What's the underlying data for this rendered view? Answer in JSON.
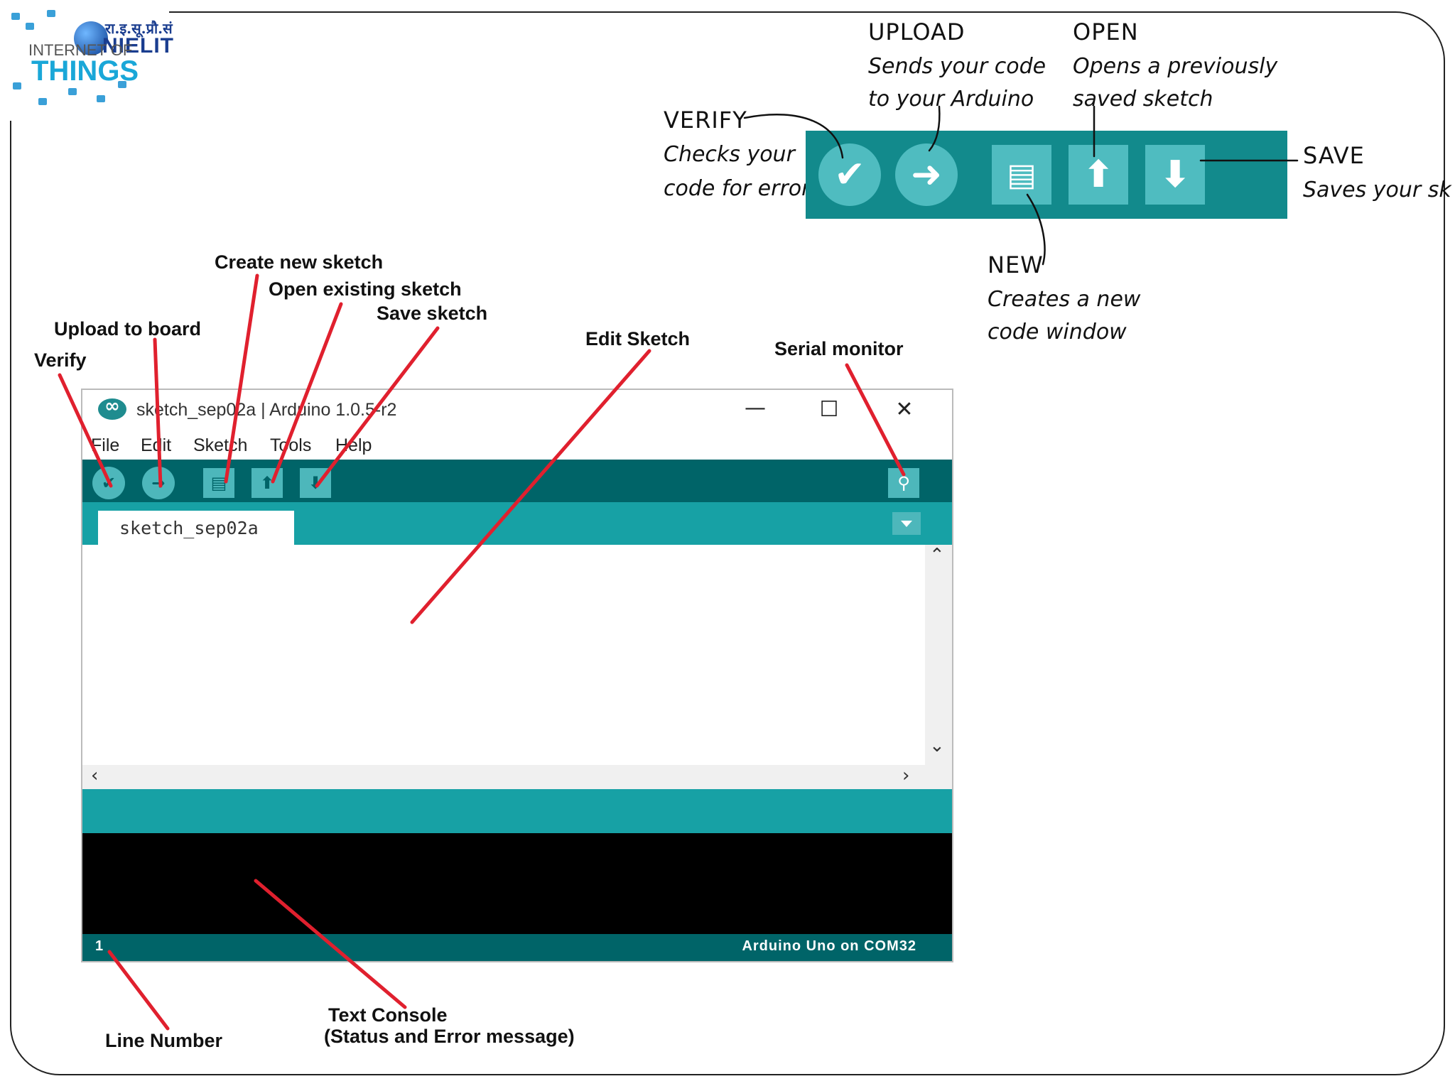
{
  "logo": {
    "hindi": "रा.इ.सू.प्रौ.सं",
    "org": "NIELIT",
    "line1": "INTERNET OF",
    "line2": "THINGS"
  },
  "handwritten": {
    "upload_title": "UPLOAD",
    "upload_desc1": "Sends your code",
    "upload_desc2": "to your Arduino",
    "open_title": "OPEN",
    "open_desc1": "Opens a previously",
    "open_desc2": "saved sketch",
    "verify_title": "VERIFY",
    "verify_desc1": "Checks your",
    "verify_desc2": "code for errors",
    "save_title": "SAVE",
    "save_desc1": "Saves your sketch",
    "new_title": "NEW",
    "new_desc1": "Creates a new",
    "new_desc2": "code window"
  },
  "labels": {
    "create_new": "Create new sketch",
    "open_existing": "Open existing sketch",
    "save_sketch": "Save sketch",
    "upload_board": "Upload to board",
    "verify": "Verify",
    "edit_sketch": "Edit Sketch",
    "serial_monitor": "Serial monitor",
    "line_number": "Line Number",
    "text_console_1": "Text Console",
    "text_console_2": "(Status and Error message)"
  },
  "window": {
    "title": "sketch_sep02a | Arduino 1.0.5-r2",
    "minimize": "—",
    "maximize": "☐",
    "close": "✕",
    "menus": [
      "File",
      "Edit",
      "Sketch",
      "Tools",
      "Help"
    ],
    "tab_label": "sketch_sep02a",
    "line_number": "1",
    "board": "Arduino Uno on COM32"
  },
  "colors": {
    "toolbar_dark": "#006468",
    "toolbar_teal": "#17a1a5",
    "button_teal": "#4db7bb",
    "big_bar": "#128a8c",
    "arrow_red": "#e0202e"
  }
}
